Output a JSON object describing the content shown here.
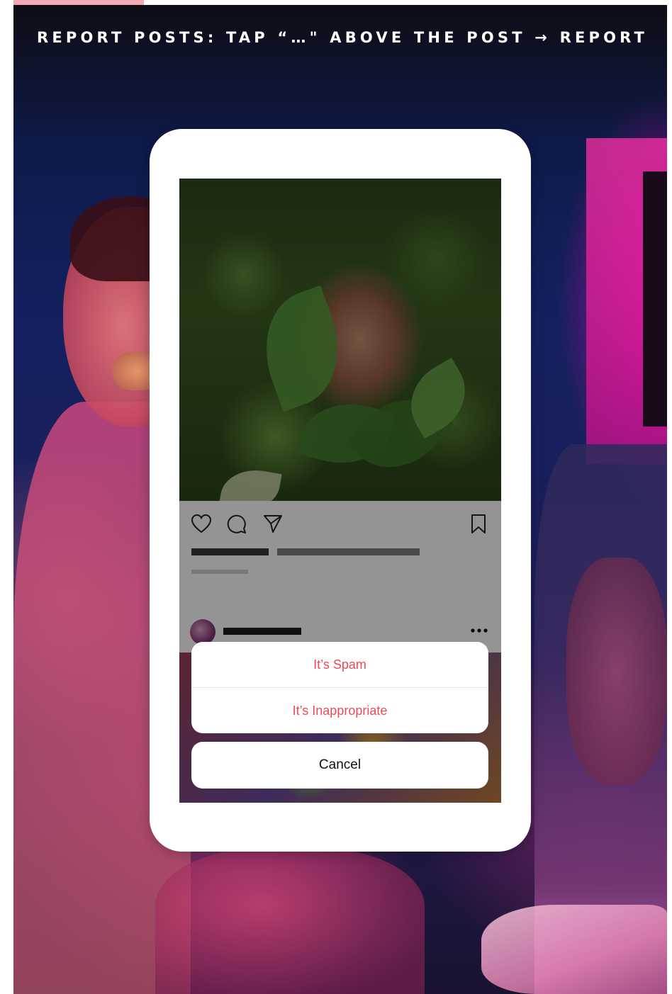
{
  "headline": "REPORT POSTS: TAP “…\" ABOVE THE POST → REPORT",
  "post": {
    "actions": {
      "like_icon": "heart-icon",
      "comment_icon": "comment-icon",
      "share_icon": "send-icon",
      "save_icon": "bookmark-icon"
    }
  },
  "next_post": {
    "more_icon": "more-icon"
  },
  "report_sheet": {
    "options": [
      {
        "label": "It’s Spam"
      },
      {
        "label": "It’s Inappropriate"
      }
    ],
    "cancel_label": "Cancel"
  },
  "colors": {
    "accent_tab": "#f4a8b4",
    "destructive_text": "#ed4956",
    "cancel_text": "#111111"
  }
}
